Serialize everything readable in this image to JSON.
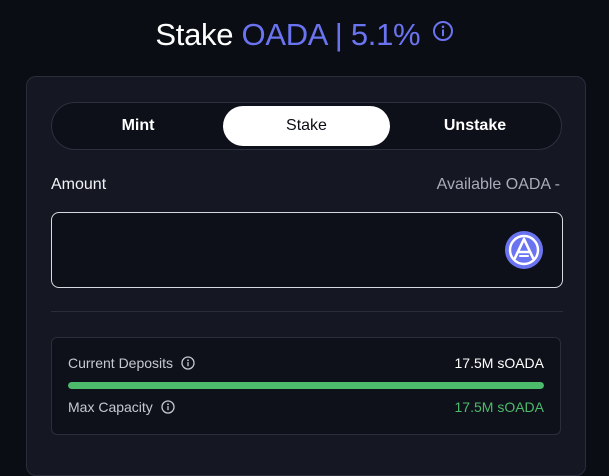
{
  "header": {
    "title_prefix": "Stake",
    "title_accent": "OADA | 5.1%",
    "info_icon": "info-circle-icon"
  },
  "tabs": [
    {
      "label": "Mint",
      "active": false
    },
    {
      "label": "Stake",
      "active": true
    },
    {
      "label": "Unstake",
      "active": false
    }
  ],
  "amount": {
    "label": "Amount",
    "available_label": "Available OADA",
    "available_value": "-",
    "value": "",
    "placeholder": "",
    "token_icon": "oada-token-icon"
  },
  "deposits": {
    "current_label": "Current Deposits",
    "current_value": "17.5M sOADA",
    "max_label": "Max Capacity",
    "max_value": "17.5M sOADA",
    "progress_fraction": 1.0
  },
  "colors": {
    "accent": "#6b74f0",
    "success": "#4cbb6c",
    "background": "#0b0d15",
    "card": "#151823"
  }
}
